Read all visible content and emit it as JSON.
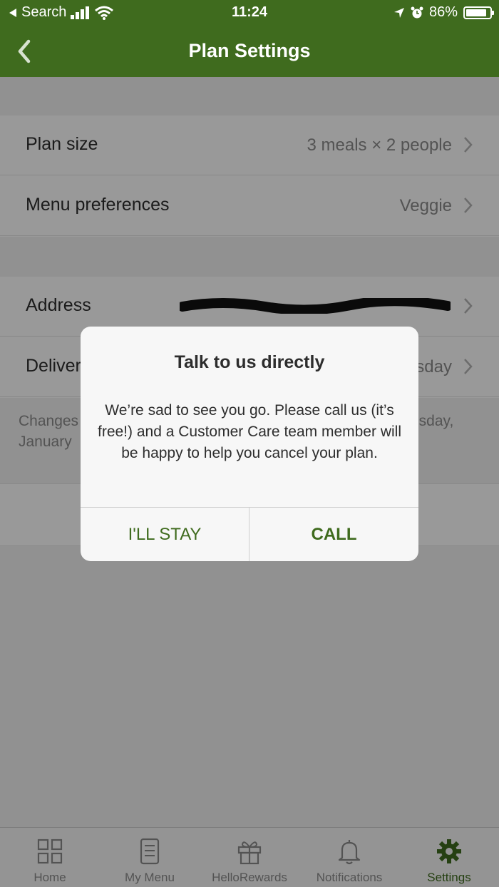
{
  "status_bar": {
    "back_app": "Search",
    "time": "11:24",
    "battery": "86%",
    "battery_level": 0.86
  },
  "nav": {
    "title": "Plan Settings",
    "back_icon": "chevron-left-icon"
  },
  "plan_group": {
    "rows": [
      {
        "label": "Plan size",
        "value": "3 meals × 2 people"
      },
      {
        "label": "Menu preferences",
        "value": "Veggie"
      }
    ]
  },
  "delivery_group": {
    "address_label": "Address",
    "delivery_label": "Deliver",
    "delivery_value": "sday",
    "note_left_1": "Changes",
    "note_left_2": "January",
    "note_right": "esday,"
  },
  "dialog": {
    "title": "Talk to us directly",
    "message": "We’re sad to see you go. Please call us (it’s free!) and a Customer Care team member will be happy to help you cancel your plan.",
    "stay_label": "I'LL STAY",
    "call_label": "CALL"
  },
  "tabs": [
    {
      "label": "Home",
      "icon": "grid-icon"
    },
    {
      "label": "My Menu",
      "icon": "menu-list-icon"
    },
    {
      "label": "HelloRewards",
      "icon": "gift-icon"
    },
    {
      "label": "Notifications",
      "icon": "bell-icon"
    },
    {
      "label": "Settings",
      "icon": "gear-icon",
      "active": true
    }
  ],
  "colors": {
    "brand_green": "#3f6b1e"
  }
}
